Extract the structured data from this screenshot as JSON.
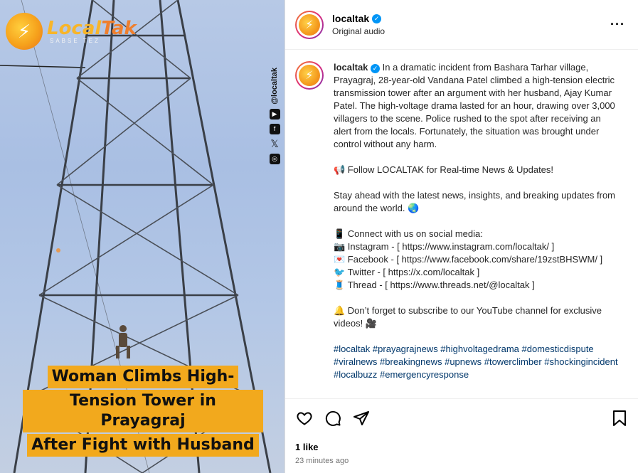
{
  "media": {
    "brand_name_a": "Local",
    "brand_name_b": "Tak",
    "brand_tagline": "SABSE TEZ",
    "side_handle": "@localtak",
    "side_icons": [
      "youtube-icon",
      "facebook-icon",
      "x-icon",
      "instagram-icon"
    ],
    "caption_lines": [
      "Woman Climbs High-",
      "Tension Tower  in Prayagraj",
      "After Fight with Husband"
    ]
  },
  "header": {
    "username": "localtak",
    "subtitle": "Original audio",
    "more_label": "···"
  },
  "caption": {
    "username": "localtak",
    "paragraphs": [
      "In a dramatic incident from Bashara Tarhar village, Prayagraj, 28-year-old Vandana Patel climbed a high-tension electric transmission tower after an argument with her husband, Ajay Kumar Patel. The high-voltage drama lasted for an hour, drawing over 3,000 villagers to the scene. Police rushed to the spot after receiving an alert from the locals. Fortunately, the situation was brought under control without any harm.",
      "📢 Follow LOCALTAK for Real-time News & Updates!",
      "Stay ahead with the latest news, insights, and breaking updates from around the world. 🌏",
      "📱 Connect with us on social media:\n📷 Instagram - [ https://www.instagram.com/localtak/ ]\n💌 Facebook - [ https://www.facebook.com/share/19zstBHSWM/ ]\n🐦 Twitter - [ https://x.com/localtak ]\n🧵 Thread - [ https://www.threads.net/@localtak ]",
      "🔔 Don’t forget to subscribe to our YouTube channel for exclusive videos! 🎥"
    ],
    "hashtags": "#localtak #prayagrajnews #highvoltagedrama #domesticdispute #viralnews #breakingnews #upnews #towerclimber #shockingincident #localbuzz #emergencyresponse"
  },
  "actions": {
    "likes": "1 like",
    "time": "23 minutes ago"
  }
}
